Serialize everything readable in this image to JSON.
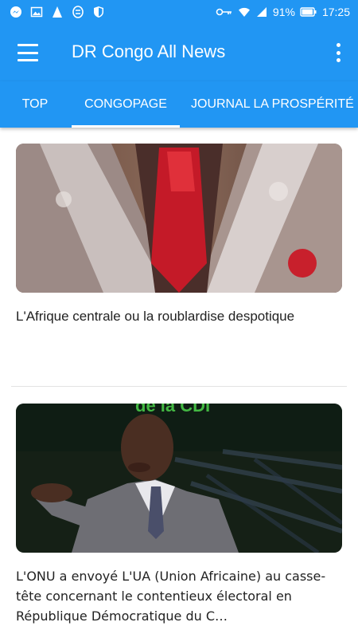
{
  "status_bar": {
    "battery_percent": "91%",
    "time": "17:25",
    "icons_left": [
      "messenger-icon",
      "gallery-icon",
      "app-icon",
      "sync-icon",
      "shield-icon"
    ],
    "icons_right": [
      "key-icon",
      "wifi-icon",
      "signal-icon",
      "battery-icon"
    ]
  },
  "app_bar": {
    "title": "DR Congo All News",
    "menu_icon": "hamburger-menu-icon",
    "more_icon": "more-vert-icon"
  },
  "tabs": [
    {
      "label": "TOP",
      "selected": false
    },
    {
      "label": "CONGOPAGE",
      "selected": true
    },
    {
      "label": "JOURNAL LA PROSPÉRITÉ",
      "selected": false
    }
  ],
  "articles": [
    {
      "title": "L'Afrique centrale ou la roublardise despotique"
    },
    {
      "title": "L'ONU a envoyé L'UA (Union Africaine) au casse-tête concernant le contentieux électoral en République Démocratique du C…",
      "image_caption": "de la CDI"
    }
  ],
  "colors": {
    "primary": "#2196F3",
    "text": "#222222"
  }
}
